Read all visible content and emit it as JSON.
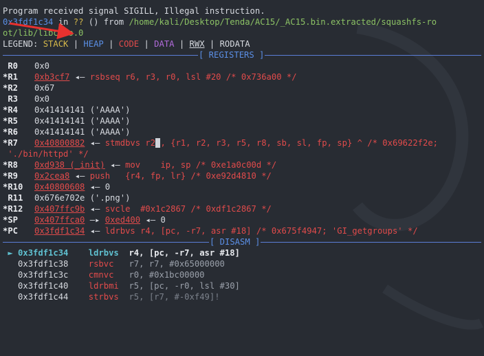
{
  "header": {
    "signal_line": "Program received signal SIGILL, Illegal instruction.",
    "pc_addr": "0x3fdf1c34",
    "in_text": " in ",
    "qq": "??",
    "from_text": " () from ",
    "path_1": "/home/kali/Desktop/Tenda/AC15/_AC15.bin.extracted/squashfs-ro",
    "path_2": "ot/lib/libc.so.0"
  },
  "legend": {
    "prefix": "LEGEND: ",
    "stack": "STACK",
    "heap": "HEAP",
    "code": "CODE",
    "data": "DATA",
    "rwx": "RWX",
    "rodata": "RODATA",
    "sep": " | "
  },
  "registers_title": "[ REGISTERS ]",
  "disasm_title": "[ DISASM ]",
  "registers": {
    "r0": {
      "label": " R0",
      "val": "0x0"
    },
    "r1": {
      "label": "*R1",
      "addr": "0xb3cf7",
      "arrow": " ◂— ",
      "rest": "rsbseq r6, r3, r0, lsl #20 /* 0x736a00 */"
    },
    "r2": {
      "label": "*R2",
      "val": "0x67"
    },
    "r3": {
      "label": " R3",
      "val": "0x0"
    },
    "r4": {
      "label": "*R4",
      "val": "0x41414141 ('AAAA')"
    },
    "r5": {
      "label": "*R5",
      "val": "0x41414141 ('AAAA')"
    },
    "r6": {
      "label": "*R6",
      "val": "0x41414141 ('AAAA')"
    },
    "r7": {
      "label": "*R7",
      "addr": "0x40800882",
      "arrow": " ◂— ",
      "ins": "stmdbvs r2",
      "cursor": " ",
      "rest": ", {r1, r2, r3, r5, r8, sb, sl, fp, sp} ^ /* 0x69622f2e;",
      "cont": " './bin/httpd' */"
    },
    "r8": {
      "label": "*R8",
      "addr": "0xd938 (_init)",
      "arrow": " ◂— ",
      "ins": "mov    ip, sp /* 0xe1a0c00d */"
    },
    "r9": {
      "label": "*R9",
      "addr": "0x2cea8",
      "arrow": " ◂— ",
      "ins": "push   {r4, fp, lr} /* 0xe92d4810 */"
    },
    "r10": {
      "label": "*R10",
      "addr": "0x40800608",
      "arrow": " ◂— ",
      "rest": "0"
    },
    "r11": {
      "label": " R11",
      "val": "0x676e702e ('.png')"
    },
    "r12": {
      "label": "*R12",
      "addr": "0x407ffc9b",
      "arrow": " ◂— ",
      "ins": "svcle  #0x1c2867 /* 0xdf1c2867 */"
    },
    "sp": {
      "label": "*SP",
      "addr": "0x407ffca0",
      "arrow": " —▸ ",
      "addr2": "0xed400",
      "arrow2": " ◂— ",
      "rest": "0"
    },
    "pc": {
      "label": "*PC",
      "addr": "0x3fdf1c34",
      "arrow": " ◂— ",
      "ins": "ldrbvs r4, [pc, -r7, asr #18] /* 0x675f4947; 'GI_getgroups' */"
    }
  },
  "disasm": [
    {
      "marker": " ► ",
      "addr": "0x3fdf1c34",
      "mnem": "ldrbvs",
      "ops": "r4, [pc, -r7, asr #18]",
      "current": true
    },
    {
      "marker": "   ",
      "addr": "0x3fdf1c38",
      "mnem": "rsbvc",
      "ops": "r7, r7, #0x65000000",
      "current": false
    },
    {
      "marker": "   ",
      "addr": "0x3fdf1c3c",
      "mnem": "cmnvc",
      "ops": "r0, #0x1bc00000",
      "current": false
    },
    {
      "marker": "   ",
      "addr": "0x3fdf1c40",
      "mnem": "ldrbmi",
      "ops": "r5, [pc, -r0, lsl #30]",
      "current": false
    },
    {
      "marker": "   ",
      "addr": "0x3fdf1c44",
      "mnem": "strbvs",
      "ops": "r5, [r7, #-0xf49]!",
      "current": false
    }
  ],
  "colors": {
    "background": "#282c33",
    "blue": "#5b8fe6",
    "red": "#e14b4b",
    "yellow": "#d6b94a",
    "green": "#8cc265",
    "orange": "#e0844a",
    "purple": "#b06ad9",
    "annotation_arrow": "#e8312f"
  },
  "icons": {
    "annotation": "red-arrow-annotation",
    "current_instruction": "right-triangle-marker"
  }
}
